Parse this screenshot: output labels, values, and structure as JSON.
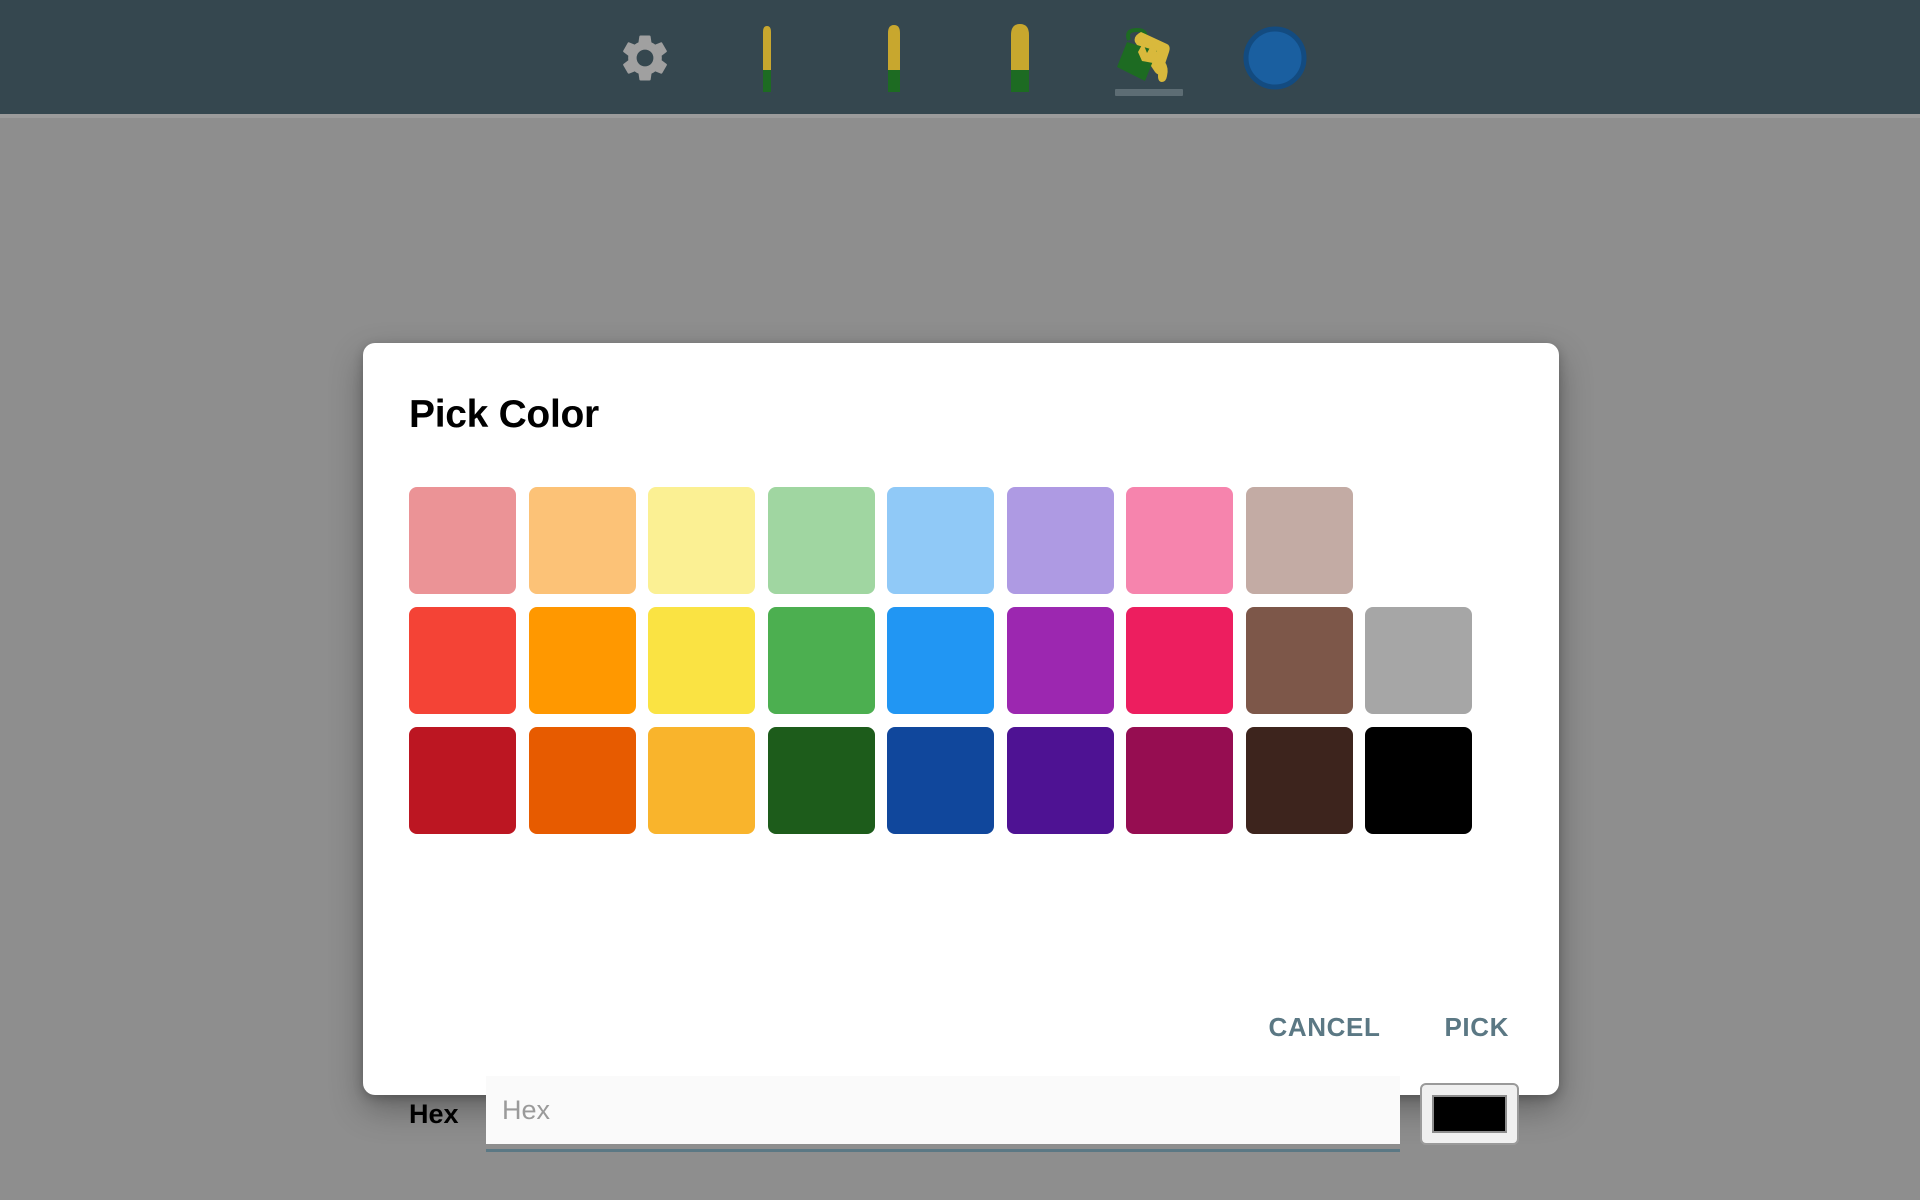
{
  "toolbar": {
    "background": "#35474f",
    "tools": [
      {
        "name": "settings",
        "icon": "gear-icon",
        "label": "Settings",
        "selected": false
      },
      {
        "name": "pen-thin",
        "icon": "pen-thin-icon",
        "label": "Thin Pen",
        "selected": false,
        "tip_color": "#c8a72e",
        "body_color": "#1d6b22"
      },
      {
        "name": "pen-medium",
        "icon": "pen-medium-icon",
        "label": "Medium Pen",
        "selected": false,
        "tip_color": "#c8a72e",
        "body_color": "#1d6b22"
      },
      {
        "name": "pen-thick",
        "icon": "pen-thick-icon",
        "label": "Thick Pen",
        "selected": false,
        "tip_color": "#c8a72e",
        "body_color": "#1d6b22"
      },
      {
        "name": "paint-bucket",
        "icon": "paint-bucket-icon",
        "label": "Fill",
        "selected": true,
        "bucket_color": "#1d6b22",
        "paint_color": "#d9b93c"
      },
      {
        "name": "color-swatch",
        "icon": "color-circle-icon",
        "label": "Current Color",
        "selected": false,
        "circle_color": "#1a5fa0",
        "ring_color": "#134b80"
      }
    ]
  },
  "backdrop": {
    "color": "#8e8e8e"
  },
  "dialog": {
    "title": "Pick Color",
    "hex": {
      "label": "Hex",
      "placeholder": "Hex",
      "value": "",
      "underline_color": "#5b7884",
      "preview_color": "#000000"
    },
    "buttons": {
      "cancel": "CANCEL",
      "pick": "PICK",
      "accent": "#5b7884"
    },
    "palette": {
      "rows": [
        {
          "name": "pastel",
          "colors": [
            "#eb9396",
            "#fcc277",
            "#fbf093",
            "#a0d6a1",
            "#90c9f7",
            "#ae9ae3",
            "#f684ad",
            "#c3aba4"
          ]
        },
        {
          "name": "bright",
          "colors": [
            "#f44336",
            "#ff9800",
            "#fae343",
            "#4caf50",
            "#2196f3",
            "#9c27b0",
            "#ed1e5f",
            "#7d5749",
            "#a6a6a6"
          ]
        },
        {
          "name": "dark",
          "colors": [
            "#bc1622",
            "#e75b00",
            "#f9b42c",
            "#1d5c1b",
            "#10479c",
            "#4e1293",
            "#960d51",
            "#3d241d",
            "#000000"
          ]
        }
      ]
    }
  }
}
